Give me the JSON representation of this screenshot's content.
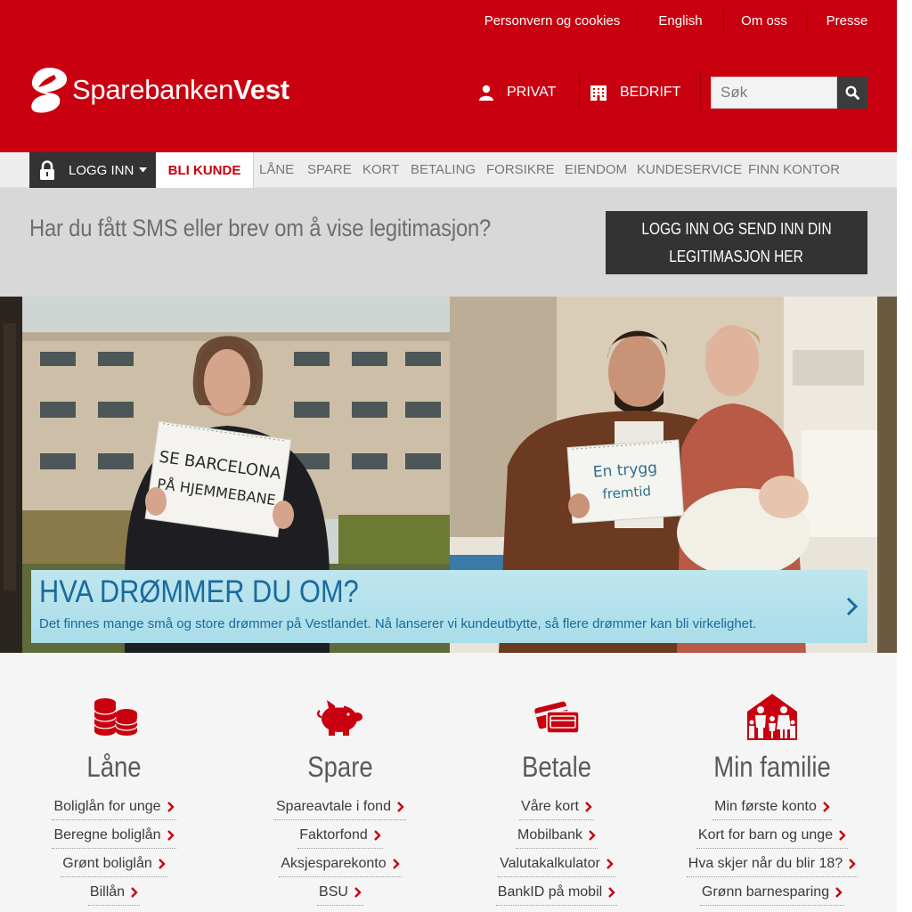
{
  "top_links": [
    "Personvern og cookies",
    "English",
    "Om oss",
    "Presse"
  ],
  "logo": {
    "part1": "Sparebanken",
    "part2": "Vest"
  },
  "segments": {
    "privat": "PRIVAT",
    "bedrift": "BEDRIFT"
  },
  "search": {
    "placeholder": "Søk"
  },
  "nav": {
    "login": "LOGG INN",
    "bli_kunde": "BLI KUNDE",
    "items": [
      "LÅNE",
      "SPARE",
      "KORT",
      "BETALING",
      "FORSIKRE",
      "EIENDOM",
      "KUNDESERVICE",
      "FINN KONTOR"
    ]
  },
  "banner": {
    "title": "Har du fått SMS eller brev om å vise legitimasjon?",
    "button_line1": "LOGG INN OG SEND INN DIN",
    "button_line2": "LEGITIMASJON HER"
  },
  "hero": {
    "sign_left_line1": "SE BARCELONA",
    "sign_left_line2": "PÅ HJEMMEBANE",
    "sign_right_line1": "En trygg",
    "sign_right_line2": "fremtid",
    "title": "HVA DRØMMER DU OM?",
    "text": "Det finnes mange små og store drømmer på Vestlandet. Nå lanserer vi kundeutbytte, så flere drømmer kan bli virkelighet."
  },
  "categories": [
    {
      "title": "Låne",
      "icon": "coins-icon",
      "links": [
        "Boliglån for unge",
        "Beregne boliglån",
        "Grønt boliglån",
        "Billån"
      ]
    },
    {
      "title": "Spare",
      "icon": "piggy-bank-icon",
      "links": [
        "Spareavtale i fond",
        "Faktorfond",
        "Aksjesparekonto",
        "BSU"
      ]
    },
    {
      "title": "Betale",
      "icon": "cards-icon",
      "links": [
        "Våre kort",
        "Mobilbank",
        "Valutakalkulator",
        "BankID på mobil"
      ]
    },
    {
      "title": "Min familie",
      "icon": "family-house-icon",
      "links": [
        "Min første konto",
        "Kort for barn og unge",
        "Hva skjer når du blir 18?",
        "Grønn barnesparing"
      ]
    }
  ],
  "colors": {
    "brand_red": "#c8000f",
    "dark": "#333333",
    "caption_bg": "#b3e0ea",
    "caption_text": "#1a6a9e"
  }
}
